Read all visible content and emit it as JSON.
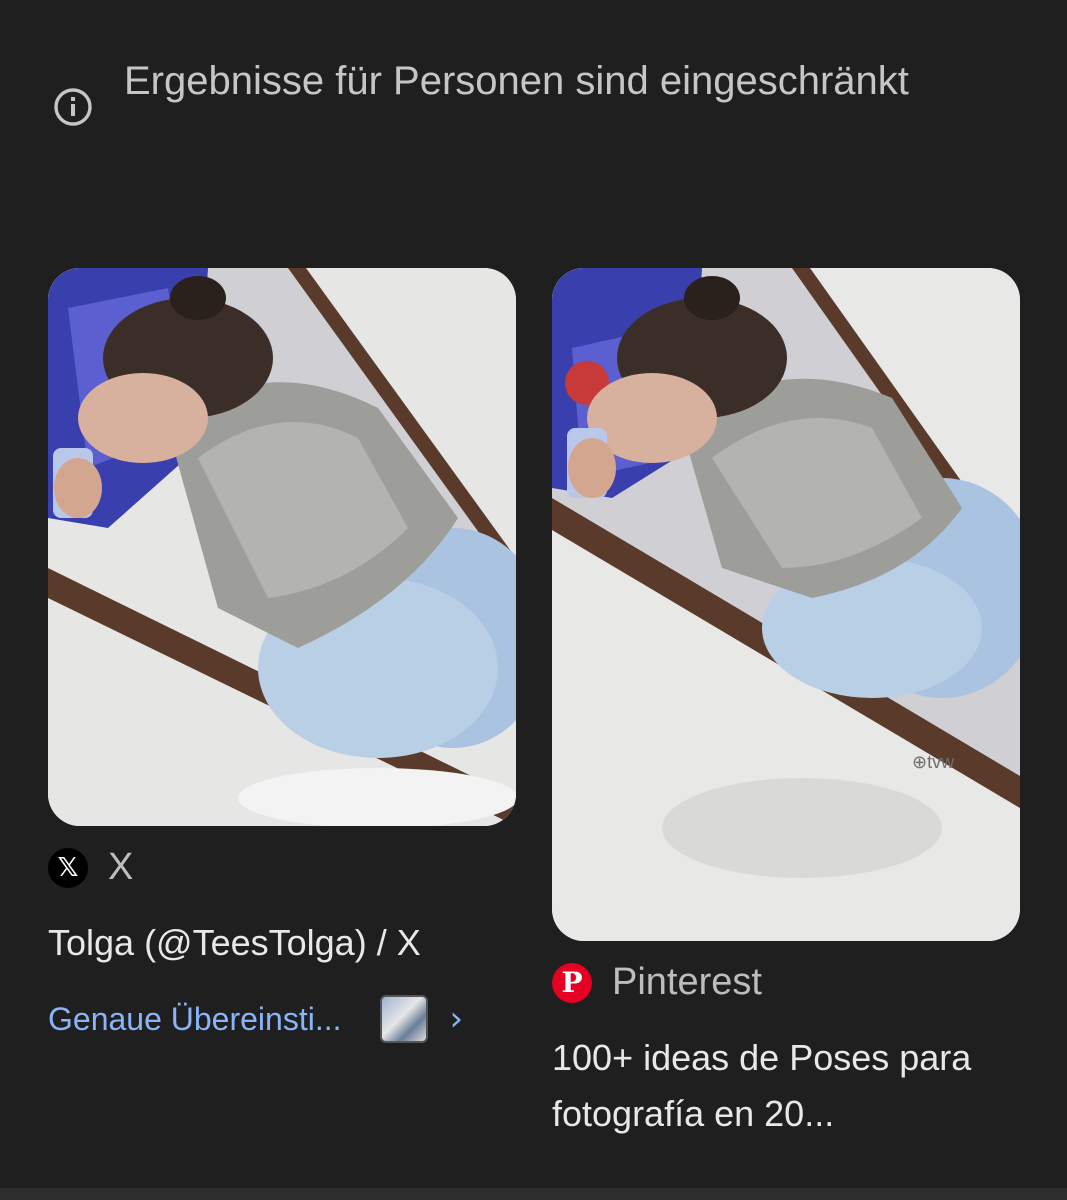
{
  "notice": {
    "icon": "info-icon",
    "text": "Ergebnisse für Personen sind eingeschränkt"
  },
  "results": [
    {
      "source_icon": "x-logo-icon",
      "source_icon_glyph": "𝕏",
      "source_name": "X",
      "title": "Tolga (@TeesTolga) / X",
      "match_label": "Genaue Übereinsti...",
      "chevron": "›"
    },
    {
      "source_icon": "pinterest-logo-icon",
      "source_icon_glyph": "P",
      "source_name": "Pinterest",
      "title": "100+ ideas de Poses para fotografía en 20...",
      "watermark": "⊕tvw"
    }
  ],
  "colors": {
    "background": "#1f1f1f",
    "link": "#8ab4f8",
    "pinterest": "#e60023"
  }
}
